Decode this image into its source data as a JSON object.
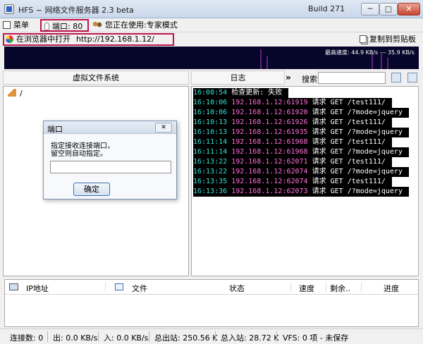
{
  "window": {
    "title": "HFS ~ 网络文件服务器 2.3 beta",
    "build": "Build 271",
    "minimize": "─",
    "maximize": "□",
    "close": "✕"
  },
  "toolbar": {
    "menu_label": "菜单",
    "port_label": "端口: 80",
    "mode_label": "您正在使用:专家模式"
  },
  "urlbar": {
    "open_label": "在浏览器中打开",
    "url": "http://192.168.1.12/",
    "copy_label": "复制到剪贴板"
  },
  "graph": {
    "label": "最高速度: 44.9 KB/s --- 35.9 KB/s"
  },
  "vfs": {
    "header": "虚拟文件系统",
    "root": "/"
  },
  "log": {
    "header": "日志",
    "arrow": "»",
    "search_label": "搜索",
    "search_value": "",
    "entries": [
      {
        "time": "16:08:54",
        "ip": "",
        "msg": "检查更新: 失败"
      },
      {
        "time": "16:10:06",
        "ip": "192.168.1.12:61919",
        "msg": "请求 GET /test111/"
      },
      {
        "time": "16:10:06",
        "ip": "192.168.1.12:61920",
        "msg": "请求 GET /?mode=jquery"
      },
      {
        "time": "16:10:13",
        "ip": "192.168.1.12:61926",
        "msg": "请求 GET /test111/"
      },
      {
        "time": "16:10:13",
        "ip": "192.168.1.12:61935",
        "msg": "请求 GET /?mode=jquery"
      },
      {
        "time": "16:11:14",
        "ip": "192.168.1.12:61968",
        "msg": "请求 GET /test111/"
      },
      {
        "time": "16:11:14",
        "ip": "192.168.1.12:61968",
        "msg": "请求 GET /?mode=jquery"
      },
      {
        "time": "16:13:22",
        "ip": "192.168.1.12:62071",
        "msg": "请求 GET /test111/"
      },
      {
        "time": "16:13:22",
        "ip": "192.168.1.12:62074",
        "msg": "请求 GET /?mode=jquery"
      },
      {
        "time": "16:13:35",
        "ip": "192.168.1.12:62074",
        "msg": "请求 GET /test111/"
      },
      {
        "time": "16:13:36",
        "ip": "192.168.1.12:62073",
        "msg": "请求 GET /?mode=jquery"
      }
    ]
  },
  "dialog": {
    "title": "端口",
    "close": "✕",
    "message_line1": "指定接收连接端口，",
    "message_line2": "留空则自动指定。",
    "input_value": "",
    "ok_label": "确定"
  },
  "connections": {
    "columns": [
      "IP地址",
      "文件",
      "状态",
      "速度",
      "剩余..",
      "进度"
    ]
  },
  "statusbar": {
    "connections": "连接数: 0",
    "out": "出: 0.0 KB/s",
    "in": "入: 0.0 KB/s",
    "total_out": "总出站: 250.56 K",
    "total_in": "总入站: 28.72 K",
    "vfs": "VFS: 0 项 - 未保存"
  },
  "colors": {
    "highlight_border": "#c0144c",
    "graph_bg": "#06062a",
    "log_time": "#35e0d0",
    "log_ip": "#ff6fd8"
  }
}
